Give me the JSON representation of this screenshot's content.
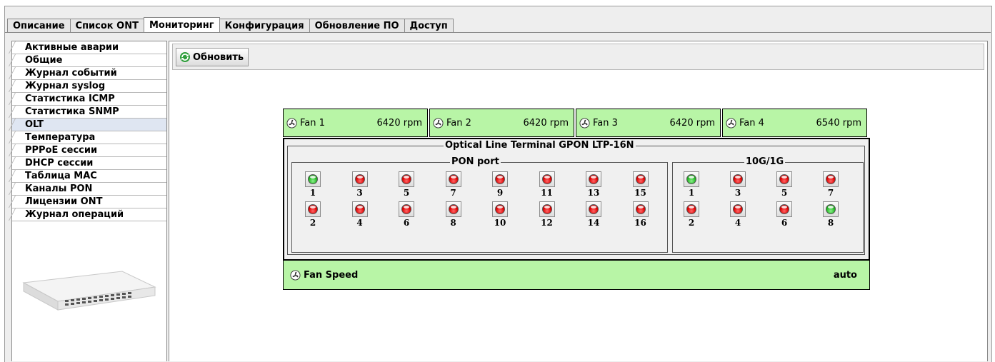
{
  "tabs": [
    "Описание",
    "Список ONT",
    "Мониторинг",
    "Конфигурация",
    "Обновление ПО",
    "Доступ"
  ],
  "active_tab": "Мониторинг",
  "menu": [
    "Активные аварии",
    "Общие",
    "Журнал событий",
    "Журнал syslog",
    "Статистика ICMP",
    "Статистика SNMP",
    "OLT",
    "Температура",
    "PPPoE сессии",
    "DHCP сессии",
    "Таблица MAC",
    "Каналы PON",
    "Лицензии ONT",
    "Журнал операций"
  ],
  "active_menu": "OLT",
  "toolbar": {
    "refresh_label": "Обновить"
  },
  "fans": [
    {
      "label": "Fan 1",
      "value": "6420 rpm"
    },
    {
      "label": "Fan 2",
      "value": "6420 rpm"
    },
    {
      "label": "Fan 3",
      "value": "6420 rpm"
    },
    {
      "label": "Fan 4",
      "value": "6540 rpm"
    }
  ],
  "olt": {
    "title": "Optical Line Terminal GPON LTP-16N",
    "pon_group": {
      "title": "PON port",
      "ports": [
        {
          "num": "1",
          "status": "green"
        },
        {
          "num": "3",
          "status": "red"
        },
        {
          "num": "5",
          "status": "red"
        },
        {
          "num": "7",
          "status": "red"
        },
        {
          "num": "9",
          "status": "red"
        },
        {
          "num": "11",
          "status": "red"
        },
        {
          "num": "13",
          "status": "red"
        },
        {
          "num": "15",
          "status": "red"
        },
        {
          "num": "2",
          "status": "red"
        },
        {
          "num": "4",
          "status": "red"
        },
        {
          "num": "6",
          "status": "red"
        },
        {
          "num": "8",
          "status": "red"
        },
        {
          "num": "10",
          "status": "red"
        },
        {
          "num": "12",
          "status": "red"
        },
        {
          "num": "14",
          "status": "red"
        },
        {
          "num": "16",
          "status": "red"
        }
      ]
    },
    "uplink_group": {
      "title": "10G/1G",
      "ports": [
        {
          "num": "1",
          "status": "green"
        },
        {
          "num": "3",
          "status": "red"
        },
        {
          "num": "5",
          "status": "red"
        },
        {
          "num": "7",
          "status": "red"
        },
        {
          "num": "2",
          "status": "red"
        },
        {
          "num": "4",
          "status": "red"
        },
        {
          "num": "6",
          "status": "red"
        },
        {
          "num": "8",
          "status": "green"
        }
      ]
    }
  },
  "fan_speed": {
    "label": "Fan Speed",
    "value": "auto"
  },
  "colors": {
    "fan_bg": "#b8f5a6",
    "led_red": "#e00000",
    "led_green": "#22b822",
    "selected": "#dfe6f2"
  },
  "icons": {
    "fan": "fan-icon",
    "refresh": "refresh-icon"
  }
}
